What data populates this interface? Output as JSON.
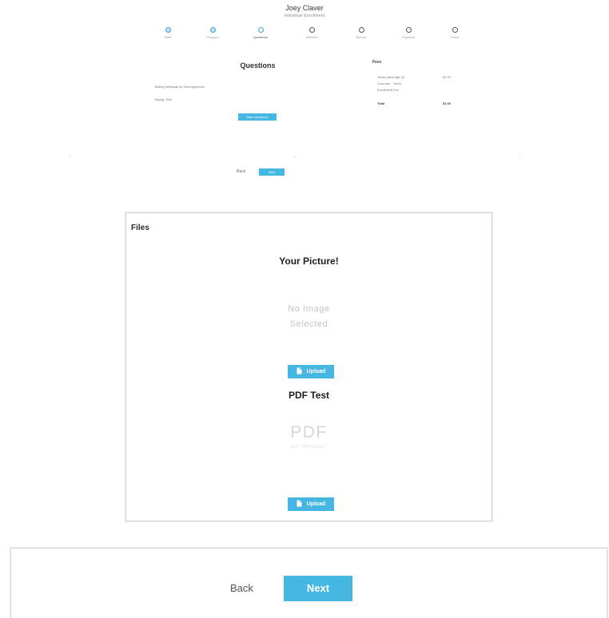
{
  "summary": {
    "name": "Joey Claver",
    "subtitle": "Individual Enrollment",
    "steps": [
      {
        "label": "Rider",
        "state": "done"
      },
      {
        "label": "Program",
        "state": "done"
      },
      {
        "label": "Questions",
        "state": "active"
      },
      {
        "label": "Waivers",
        "state": "todo"
      },
      {
        "label": "Review",
        "state": "todo"
      },
      {
        "label": "Payment",
        "state": "todo"
      },
      {
        "label": "Finish",
        "state": "todo"
      }
    ],
    "questions": {
      "title": "Questions",
      "line1": "Testing Message for Demographics",
      "line2": "Saying, Test",
      "button_label": "Start Questions"
    },
    "fees": {
      "title": "Fees",
      "rows": [
        {
          "label": "Texas Adult Age 18",
          "value": "$1.00"
        },
        {
          "label": "Colorado - Youth",
          "value": ""
        },
        {
          "label": "Enrollment Fee",
          "value": ""
        }
      ],
      "total_label": "Total",
      "total_value": "$1.00"
    },
    "nav": {
      "back_label": "Back",
      "next_label": "Next"
    }
  },
  "files": {
    "title": "Files",
    "picture": {
      "title": "Your Picture!",
      "placeholder_line1": "No Image",
      "placeholder_line2": "Selected",
      "upload_label": "Upload"
    },
    "pdf": {
      "title": "PDF Test",
      "placeholder": "PDF",
      "placeholder_sub": "NOT UPLOADED",
      "upload_label": "Upload"
    }
  },
  "nav": {
    "back_label": "Back",
    "next_label": "Next"
  },
  "colors": {
    "accent": "#46b6e3",
    "border": "#d4d4d4",
    "placeholder": "#c4c4c4"
  }
}
